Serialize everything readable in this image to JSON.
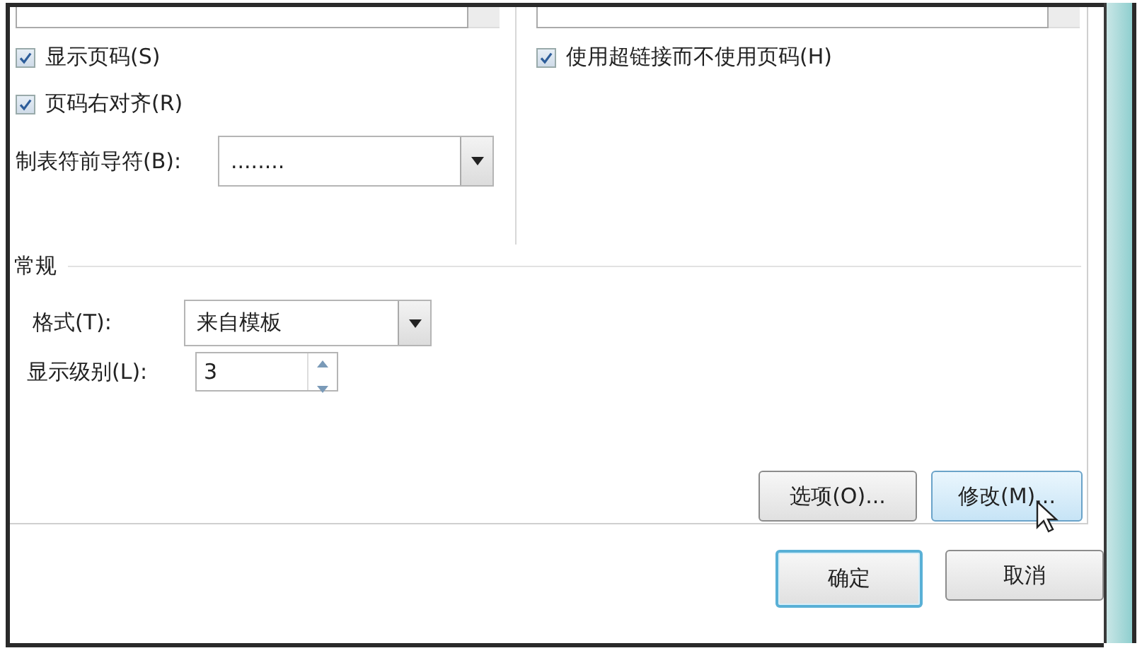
{
  "print_preview": {
    "checks": [
      {
        "label": "显示页码(S)",
        "checked": true
      },
      {
        "label": "页码右对齐(R)",
        "checked": true
      }
    ],
    "tab_leader": {
      "label": "制表符前导符(B):",
      "value": "........"
    }
  },
  "web_preview": {
    "checks": [
      {
        "label": "使用超链接而不使用页码(H)",
        "checked": true
      }
    ]
  },
  "general": {
    "title": "常规",
    "format": {
      "label": "格式(T):",
      "value": "来自模板"
    },
    "show_levels": {
      "label": "显示级别(L):",
      "value": "3"
    }
  },
  "panel_buttons": [
    {
      "label": "选项(O)...",
      "hovered": false
    },
    {
      "label": "修改(M)...",
      "hovered": true
    }
  ],
  "dialog_buttons": [
    {
      "label": "确定",
      "default": true
    },
    {
      "label": "取消",
      "default": false
    }
  ]
}
